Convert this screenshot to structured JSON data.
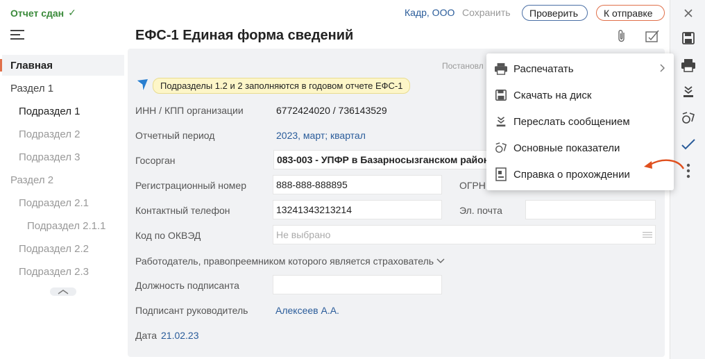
{
  "header": {
    "status": "Отчет сдан",
    "org_link": "Кадр, ООО",
    "save_label": "Сохранить",
    "check_label": "Проверить",
    "send_label": "К отправке"
  },
  "title": "ЕФС-1 Единая форма сведений",
  "sidebar": {
    "items": [
      {
        "label": "Главная"
      },
      {
        "label": "Раздел 1"
      },
      {
        "label": "Подраздел 1"
      },
      {
        "label": "Подраздел 2"
      },
      {
        "label": "Подраздел 3"
      },
      {
        "label": "Раздел 2"
      },
      {
        "label": "Подраздел 2.1"
      },
      {
        "label": "Подраздел 2.1.1"
      },
      {
        "label": "Подраздел 2.2"
      },
      {
        "label": "Подраздел 2.3"
      }
    ]
  },
  "form": {
    "post_label": "Постановл",
    "hint": "Подразделы 1.2 и 2 заполняются в годовом отчете ЕФС-1",
    "inn_label": "ИНН / КПП организации",
    "inn_value": "6772424020 / 736143529",
    "period_label": "Отчетный период",
    "period_value": "2023, март; квартал",
    "gov_label": "Госорган",
    "gov_value": "083-003 - УПФР в Базарносызганском район",
    "reg_label": "Регистрационный номер",
    "reg_value": "888-888-888895",
    "ogrn_label": "ОГРН",
    "phone_label": "Контактный телефон",
    "phone_value": "13241343213214",
    "email_label": "Эл. почта",
    "okved_label": "Код по ОКВЭД",
    "okved_placeholder": "Не выбрано",
    "employer_label": "Работодатель, правопреемником которого является страхователь",
    "signer_pos_label": "Должность подписанта",
    "signer_label": "Подписант руководитель",
    "signer_value": "Алексеев А.А.",
    "date_label": "Дата",
    "date_value": "21.02.23"
  },
  "menu": {
    "items": [
      {
        "label": "Распечатать"
      },
      {
        "label": "Скачать на диск"
      },
      {
        "label": "Переслать сообщением"
      },
      {
        "label": "Основные показатели"
      },
      {
        "label": "Справка о прохождении"
      }
    ]
  },
  "colors": {
    "accent": "#e0704a",
    "link": "#2a5c9a",
    "success": "#3a8a3a",
    "hint_bg": "#fdf6c8"
  }
}
